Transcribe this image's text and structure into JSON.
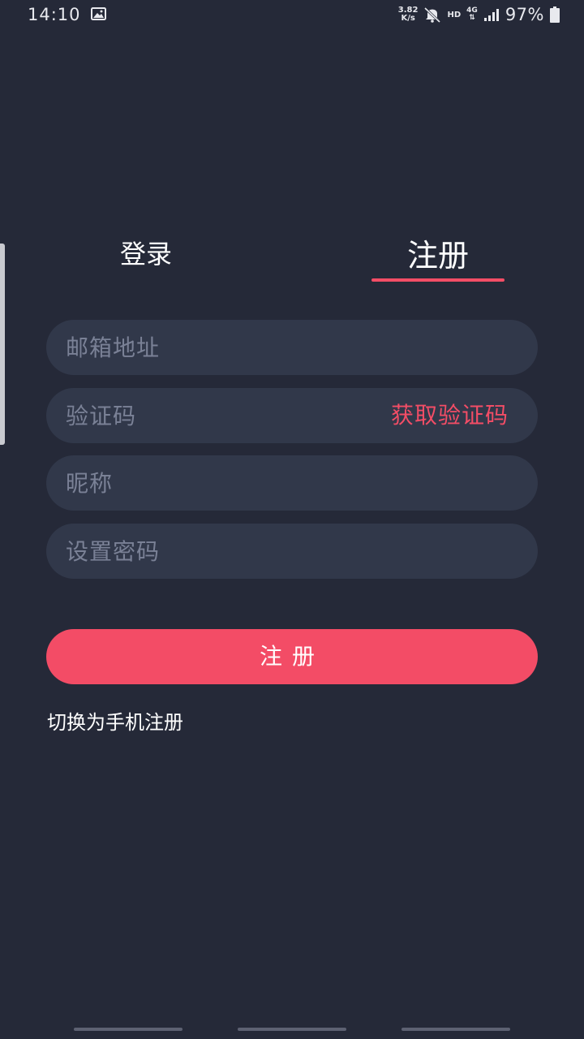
{
  "status_bar": {
    "time": "14:10",
    "net_speed_value": "3.82",
    "net_speed_unit": "K/s",
    "hd": "HD",
    "network": "4G",
    "battery": "97%"
  },
  "tabs": {
    "login": "登录",
    "register": "注册",
    "active": "register"
  },
  "form": {
    "email_placeholder": "邮箱地址",
    "code_placeholder": "验证码",
    "get_code_label": "获取验证码",
    "nickname_placeholder": "昵称",
    "password_placeholder": "设置密码",
    "submit_label": "注册"
  },
  "switch_link": "切换为手机注册",
  "colors": {
    "background": "#252938",
    "field": "#31384a",
    "accent": "#f34d66"
  }
}
